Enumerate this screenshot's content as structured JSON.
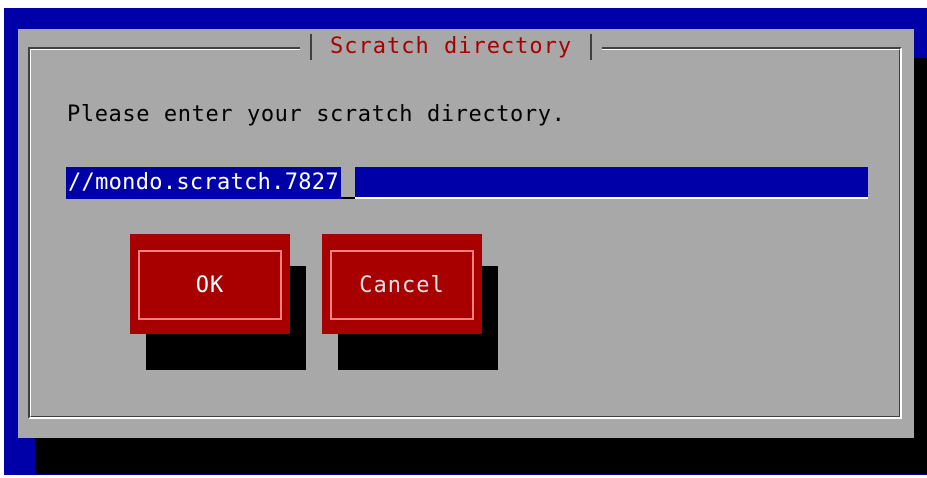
{
  "dialog": {
    "title": "Scratch directory",
    "prompt": "Please enter your scratch directory.",
    "input_value": "//mondo.scratch.7827",
    "buttons": {
      "ok_label": "OK",
      "cancel_label": "Cancel"
    }
  },
  "colors": {
    "background": "#0000a8",
    "dialog": "#a8a8a8",
    "title_text": "#a80000",
    "button": "#a80000",
    "input_background": "#0000a8"
  }
}
